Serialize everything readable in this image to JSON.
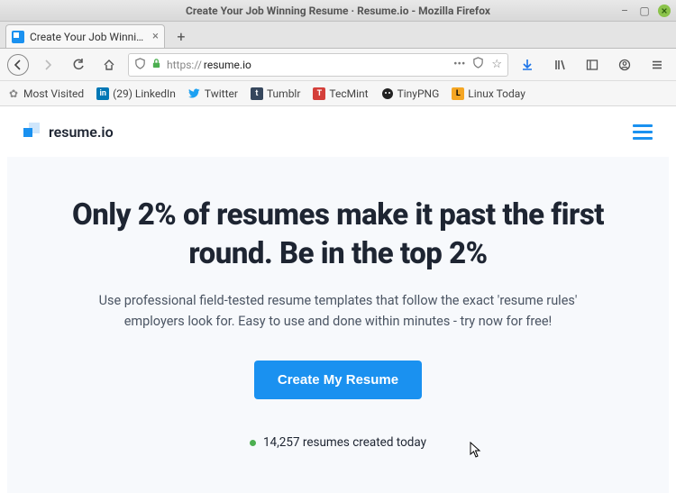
{
  "window": {
    "title": "Create Your Job Winning Resume · Resume.io - Mozilla Firefox"
  },
  "tab": {
    "label": "Create Your Job Winning Res"
  },
  "url": {
    "protocol": "https://",
    "domain": "resume.io"
  },
  "bookmarks": {
    "most_visited": "Most Visited",
    "linkedin": "(29) LinkedIn",
    "twitter": "Twitter",
    "tumblr": "Tumblr",
    "tecmint": "TecMint",
    "tinypng": "TinyPNG",
    "linuxtoday": "Linux Today"
  },
  "brand": {
    "name": "resume.io"
  },
  "hero": {
    "headline": "Only 2% of resumes make it past the first round. Be in the top 2%",
    "subtext": "Use professional field-tested resume templates that follow the exact 'resume rules' employers look for. Easy to use and done within minutes - try now for free!",
    "cta_label": "Create My Resume",
    "stat": "14,257 resumes created today"
  }
}
